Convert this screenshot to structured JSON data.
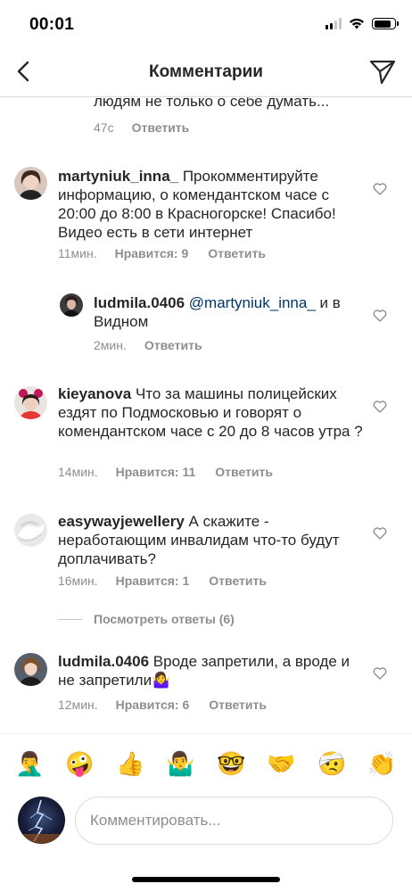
{
  "status_bar": {
    "time": "00:01"
  },
  "header": {
    "title": "Комментарии"
  },
  "partial_comment": {
    "text": "людям не только о себе думать...",
    "time": "47с",
    "reply_label": "Ответить"
  },
  "comments": [
    {
      "username": "martyniuk_inna_",
      "text": " Прокомментируйте информацию, о комендантском часе с 20:00 до 8:00 в Красногорске! Спасибо! Видео есть в сети интернет",
      "time": "11мин.",
      "likes": "Нравится: 9",
      "reply_label": "Ответить"
    },
    {
      "username": "ludmila.0406",
      "mention": "@martyniuk_inna_",
      "text": " и в Видном",
      "time": "2мин.",
      "reply_label": "Ответить"
    },
    {
      "username": "kieyanova",
      "text": " Что за машины полицейских ездят по Подмосковью и говорят о комендантском часе с 20 до 8 часов утра ?",
      "time": "14мин.",
      "likes": "Нравится: 11",
      "reply_label": "Ответить"
    },
    {
      "username": "easywayjewellery",
      "text": " А скажите - неработающим инвалидам что-то будут доплачивать?",
      "time": "16мин.",
      "likes": "Нравится: 1",
      "reply_label": "Ответить"
    },
    {
      "username": "ludmila.0406",
      "text": " Вроде запретили, а вроде и не запретили🤷‍♀️",
      "time": "12мин.",
      "likes": "Нравится: 6",
      "reply_label": "Ответить"
    }
  ],
  "view_replies": "Посмотреть ответы (6)",
  "emoji_bar": [
    "🤦‍♂️",
    "🤪",
    "👍",
    "🤷‍♂️",
    "🤓",
    "🤝",
    "🤕",
    "👏"
  ],
  "input": {
    "placeholder": "Комментировать..."
  }
}
